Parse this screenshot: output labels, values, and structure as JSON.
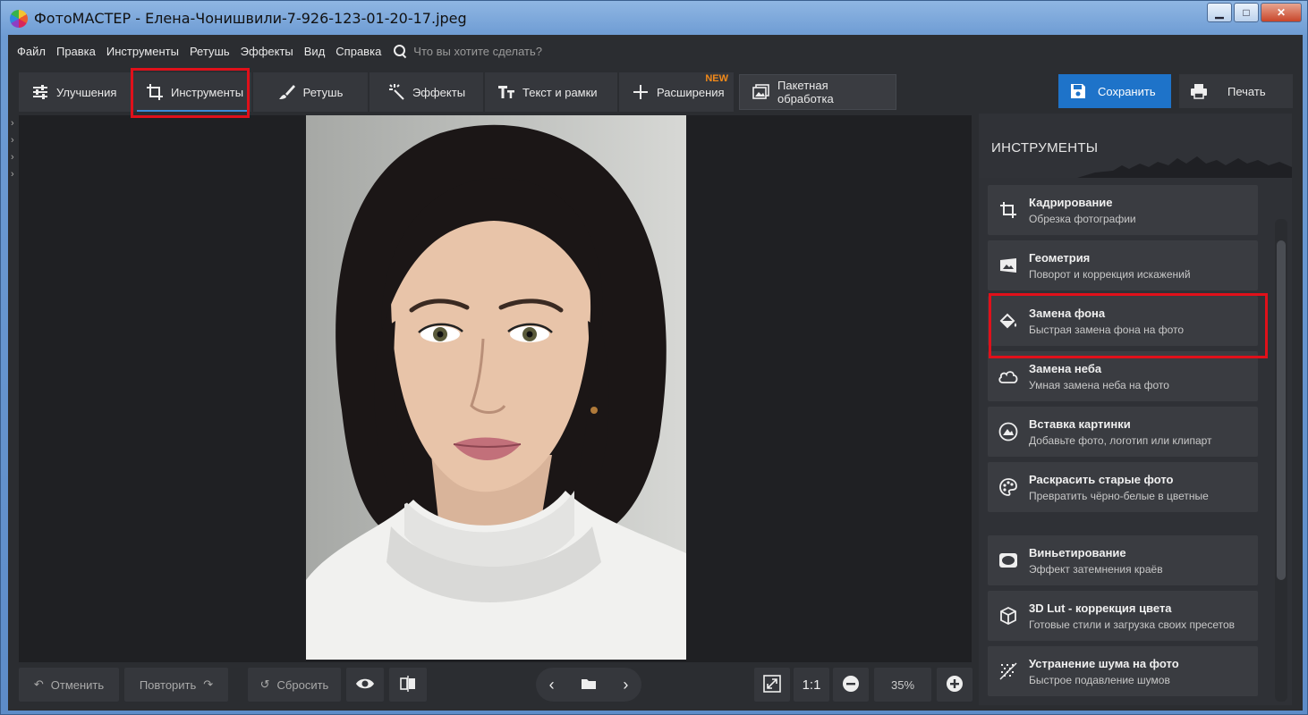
{
  "window": {
    "title": "ФотоМАСТЕР - Елена-Чонишвили-7-926-123-01-20-17.jpeg",
    "buttons": {
      "minimize": "▁",
      "maximize": "□",
      "close": "✕"
    }
  },
  "menu": {
    "items": [
      "Файл",
      "Правка",
      "Инструменты",
      "Ретушь",
      "Эффекты",
      "Вид",
      "Справка"
    ],
    "search_placeholder": "Что вы хотите сделать?"
  },
  "toolbar": {
    "tabs": [
      {
        "label": "Улучшения",
        "icon": "sliders-icon"
      },
      {
        "label": "Инструменты",
        "icon": "crop-icon",
        "active": true
      },
      {
        "label": "Ретушь",
        "icon": "brush-icon"
      },
      {
        "label": "Эффекты",
        "icon": "sparkle-icon"
      },
      {
        "label": "Текст и рамки",
        "icon": "text-icon"
      },
      {
        "label": "Расширения",
        "icon": "plus-icon",
        "badge": "NEW"
      }
    ],
    "batch_label": "Пакетная обработка",
    "save_label": "Сохранить",
    "print_label": "Печать"
  },
  "bottom_bar": {
    "undo_label": "Отменить",
    "redo_label": "Повторить",
    "reset_label": "Сбросить",
    "ratio_label": "1:1",
    "zoom_value": "35%"
  },
  "panel": {
    "title": "ИНСТРУМЕНТЫ",
    "items": [
      {
        "title": "Кадрирование",
        "subtitle": "Обрезка фотографии",
        "icon": "crop-icon"
      },
      {
        "title": "Геометрия",
        "subtitle": "Поворот и коррекция искажений",
        "icon": "geometry-icon"
      },
      {
        "title": "Замена фона",
        "subtitle": "Быстрая замена фона на фото",
        "icon": "paint-bucket-icon"
      },
      {
        "title": "Замена неба",
        "subtitle": "Умная замена неба на фото",
        "icon": "cloud-icon"
      },
      {
        "title": "Вставка картинки",
        "subtitle": "Добавьте фото, логотип или клипарт",
        "icon": "insert-image-icon"
      },
      {
        "title": "Раскрасить старые фото",
        "subtitle": "Превратить чёрно-белые в цветные",
        "icon": "palette-icon"
      },
      {
        "title": "Виньетирование",
        "subtitle": "Эффект затемнения краёв",
        "icon": "vignette-icon"
      },
      {
        "title": "3D Lut - коррекция цвета",
        "subtitle": "Готовые стили и загрузка своих пресетов",
        "icon": "cube-icon"
      },
      {
        "title": "Устранение шума на фото",
        "subtitle": "Быстрое подавление шумов",
        "icon": "noise-icon"
      }
    ]
  },
  "colors": {
    "accent": "#1e73c9",
    "highlight": "#e0101a",
    "panel_bg": "#2f3136",
    "canvas_bg": "#1f2023"
  }
}
